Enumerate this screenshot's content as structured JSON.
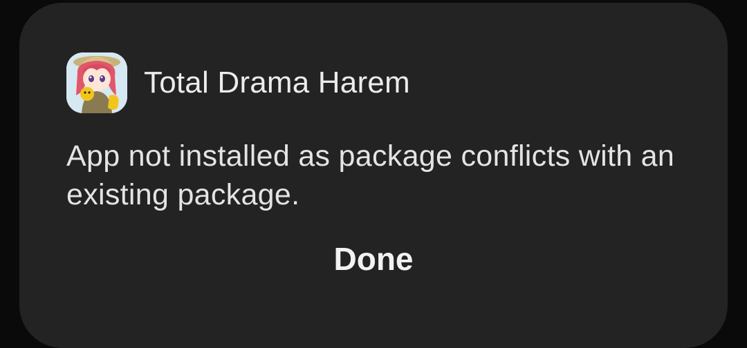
{
  "dialog": {
    "app_icon": "anime-girl-app-icon",
    "app_name": "Total Drama Harem",
    "message": "App not installed as package conflicts with an existing package.",
    "done_label": "Done"
  },
  "colors": {
    "background": "#0a0a0a",
    "dialog_surface": "#232323",
    "text_primary": "#ececec"
  }
}
